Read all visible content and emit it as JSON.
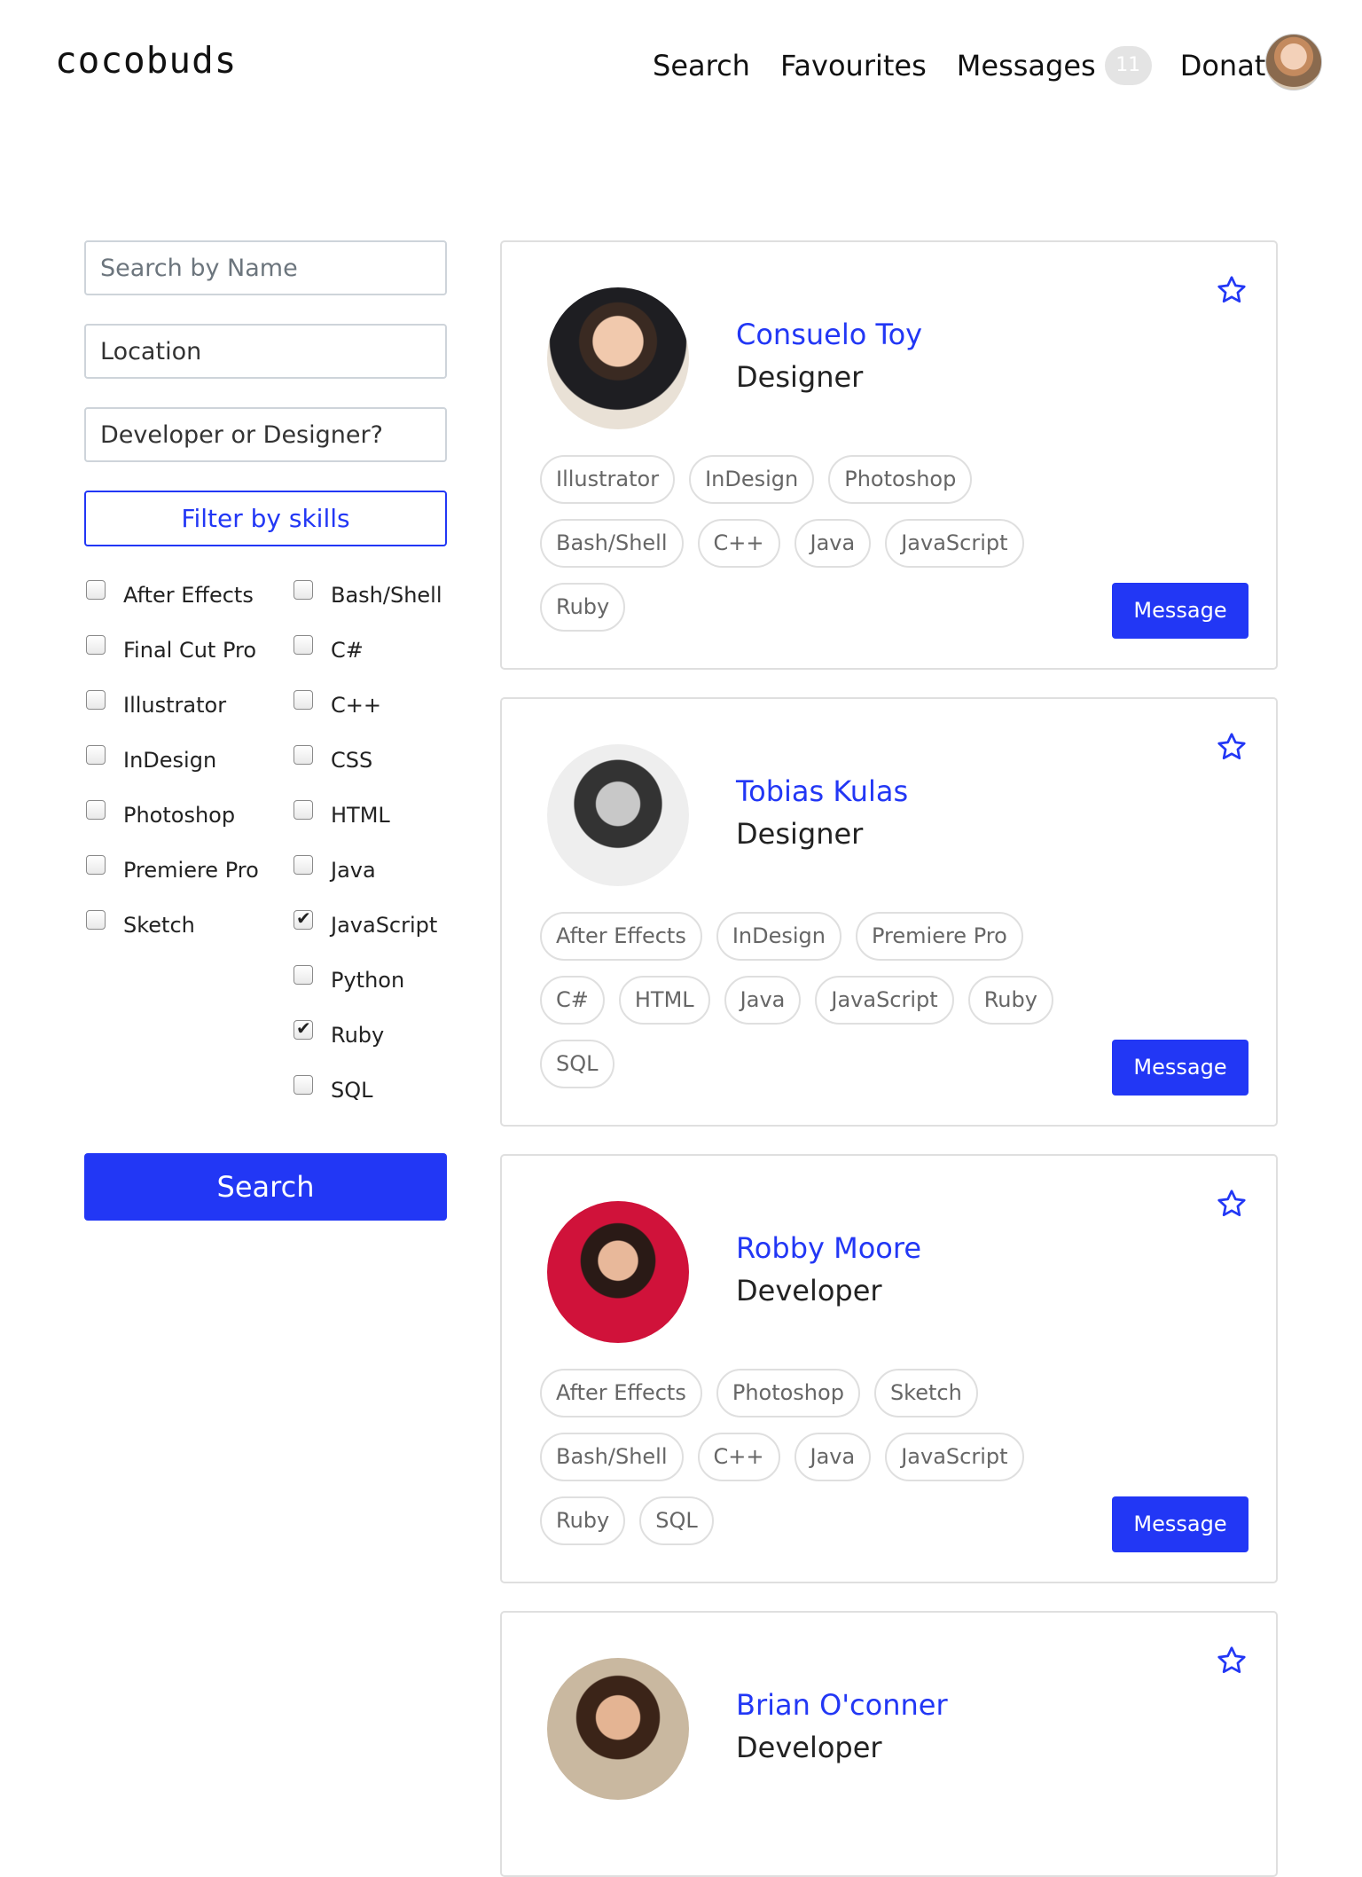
{
  "nav": {
    "logo": "cocobuds",
    "links": {
      "search": "Search",
      "favourites": "Favourites",
      "messages": "Messages",
      "donate": "Donate"
    },
    "message_count": "11"
  },
  "sidebar": {
    "name_placeholder": "Search by Name",
    "location_placeholder": "Location",
    "role_placeholder": "Developer or Designer?",
    "filter_label": "Filter by skills",
    "skills_left": [
      {
        "label": "After Effects",
        "checked": false
      },
      {
        "label": "Final Cut Pro",
        "checked": false
      },
      {
        "label": "Illustrator",
        "checked": false
      },
      {
        "label": "InDesign",
        "checked": false
      },
      {
        "label": "Photoshop",
        "checked": false
      },
      {
        "label": "Premiere Pro",
        "checked": false
      },
      {
        "label": "Sketch",
        "checked": false
      }
    ],
    "skills_right": [
      {
        "label": "Bash/Shell",
        "checked": false
      },
      {
        "label": "C#",
        "checked": false
      },
      {
        "label": "C++",
        "checked": false
      },
      {
        "label": "CSS",
        "checked": false
      },
      {
        "label": "HTML",
        "checked": false
      },
      {
        "label": "Java",
        "checked": false
      },
      {
        "label": "JavaScript",
        "checked": true
      },
      {
        "label": "Python",
        "checked": false
      },
      {
        "label": "Ruby",
        "checked": true
      },
      {
        "label": "SQL",
        "checked": false
      }
    ],
    "search_label": "Search"
  },
  "message_label": "Message",
  "colors": {
    "accent": "#2237f5",
    "border": "#dfdfdf"
  },
  "profiles": [
    {
      "name": "Consuelo Toy",
      "role": "Designer",
      "tag_rows": [
        [
          "Illustrator",
          "InDesign",
          "Photoshop"
        ],
        [
          "Bash/Shell",
          "C++",
          "Java",
          "JavaScript"
        ],
        [
          "Ruby"
        ]
      ]
    },
    {
      "name": "Tobias Kulas",
      "role": "Designer",
      "tag_rows": [
        [
          "After Effects",
          "InDesign",
          "Premiere Pro"
        ],
        [
          "C#",
          "HTML",
          "Java",
          "JavaScript",
          "Ruby"
        ],
        [
          "SQL"
        ]
      ]
    },
    {
      "name": "Robby Moore",
      "role": "Developer",
      "tag_rows": [
        [
          "After Effects",
          "Photoshop",
          "Sketch"
        ],
        [
          "Bash/Shell",
          "C++",
          "Java",
          "JavaScript"
        ],
        [
          "Ruby",
          "SQL"
        ]
      ]
    },
    {
      "name": "Brian O'conner",
      "role": "Developer",
      "tag_rows": []
    }
  ]
}
